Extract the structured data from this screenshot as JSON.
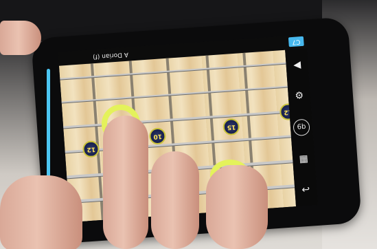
{
  "app": {
    "title": "A Dorian (f)",
    "key_badge": "C7"
  },
  "markers": [
    {
      "label": "12"
    },
    {
      "label": "10"
    },
    {
      "label": "15"
    },
    {
      "label": "12"
    }
  ],
  "sidebar": {
    "items": [
      {
        "icon": "play-icon",
        "glyph": "◀"
      },
      {
        "icon": "gear-icon",
        "glyph": "⚙"
      },
      {
        "icon": "circle-label-icon",
        "glyph": "6b"
      },
      {
        "icon": "fretboard-view-icon",
        "glyph": "▦"
      },
      {
        "icon": "back-icon",
        "glyph": "↩"
      }
    ]
  },
  "colors": {
    "accent": "#47b8ee",
    "touch_ring": "#e4f25b",
    "marker_text": "#ffe45a"
  }
}
